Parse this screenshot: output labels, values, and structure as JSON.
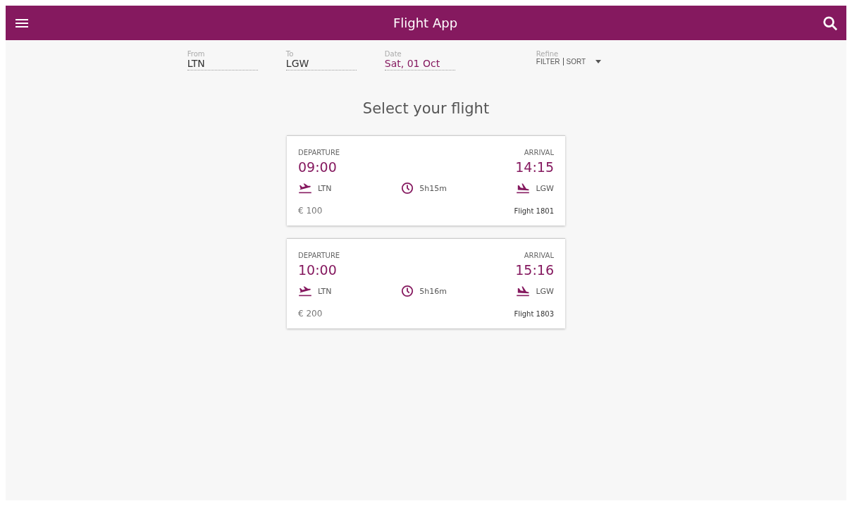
{
  "app_bar": {
    "title": "Flight App"
  },
  "search": {
    "fields": [
      {
        "label": "From",
        "value": "LTN"
      },
      {
        "label": "To",
        "value": "LGW"
      },
      {
        "label": "Date",
        "value": "Sat, 01 Oct"
      }
    ],
    "refine": {
      "label": "Refine",
      "options": [
        "FILTER",
        "SORT"
      ]
    }
  },
  "heading": "Select your flight",
  "flights": [
    {
      "departure_label": "DEPARTURE",
      "departure_time": "09:00",
      "arrival_label": "ARRIVAL",
      "arrival_time": "14:15",
      "origin": "LTN",
      "duration": "5h15m",
      "destination": "LGW",
      "price": "€ 100",
      "flight": "Flight 1801"
    },
    {
      "departure_label": "DEPARTURE",
      "departure_time": "10:00",
      "arrival_label": "ARRIVAL",
      "arrival_time": "15:16",
      "origin": "LTN",
      "duration": "5h16m",
      "destination": "LGW",
      "price": "€ 200",
      "flight": "Flight 1803"
    }
  ]
}
